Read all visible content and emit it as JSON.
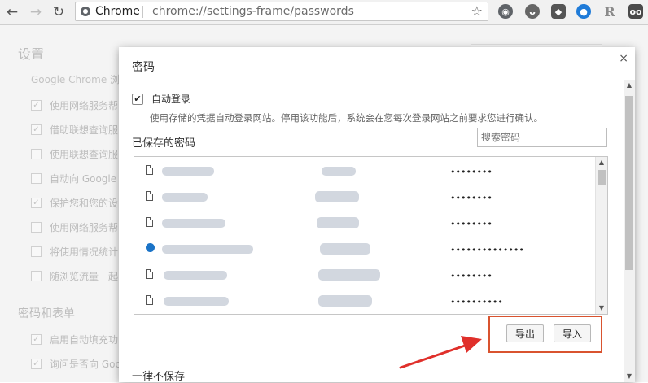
{
  "browser": {
    "app_name": "Chrome",
    "url": "chrome://settings-frame/passwords"
  },
  "settings_page": {
    "title": "设置",
    "description": "Google Chrome 浏览",
    "options": [
      {
        "label": "使用网络服务帮",
        "checked": true
      },
      {
        "label": "借助联想查询服",
        "checked": true
      },
      {
        "label": "使用联想查询服",
        "checked": false
      },
      {
        "label": "自动向 Google 发",
        "checked": false
      },
      {
        "label": "保护您和您的设",
        "checked": true
      },
      {
        "label": "使用网络服务帮",
        "checked": false
      },
      {
        "label": "将使用情况统计",
        "checked": false
      },
      {
        "label": "随浏览流量一起",
        "checked": false
      }
    ],
    "section2_title": "密码和表单",
    "section2_options": [
      {
        "label": "启用自动填充功",
        "checked": true
      },
      {
        "label": "询问是否向 Goo",
        "checked": true
      }
    ]
  },
  "dialog": {
    "title": "密码",
    "close_symbol": "×",
    "autologin_label": "自动登录",
    "autologin_checked": true,
    "autologin_description": "使用存储的凭据自动登录网站。停用该功能后，系统会在您每次登录网站之前要求您进行确认。",
    "saved_passwords_title": "已保存的密码",
    "search_placeholder": "搜索密码",
    "passwords": [
      {
        "icon": "file-icon",
        "masked": "••••••••"
      },
      {
        "icon": "file-icon",
        "masked": "••••••••"
      },
      {
        "icon": "file-icon",
        "masked": "••••••••"
      },
      {
        "icon": "globe-dot-icon",
        "masked": "••••••••••••••"
      },
      {
        "icon": "file-icon",
        "masked": "••••••••"
      },
      {
        "icon": "file-icon",
        "masked": "••••••••••"
      }
    ],
    "export_label": "导出",
    "import_label": "导入",
    "never_saved_title": "一律不保存"
  },
  "colors": {
    "highlight": "#d9532f",
    "arrow": "#e0302b"
  }
}
